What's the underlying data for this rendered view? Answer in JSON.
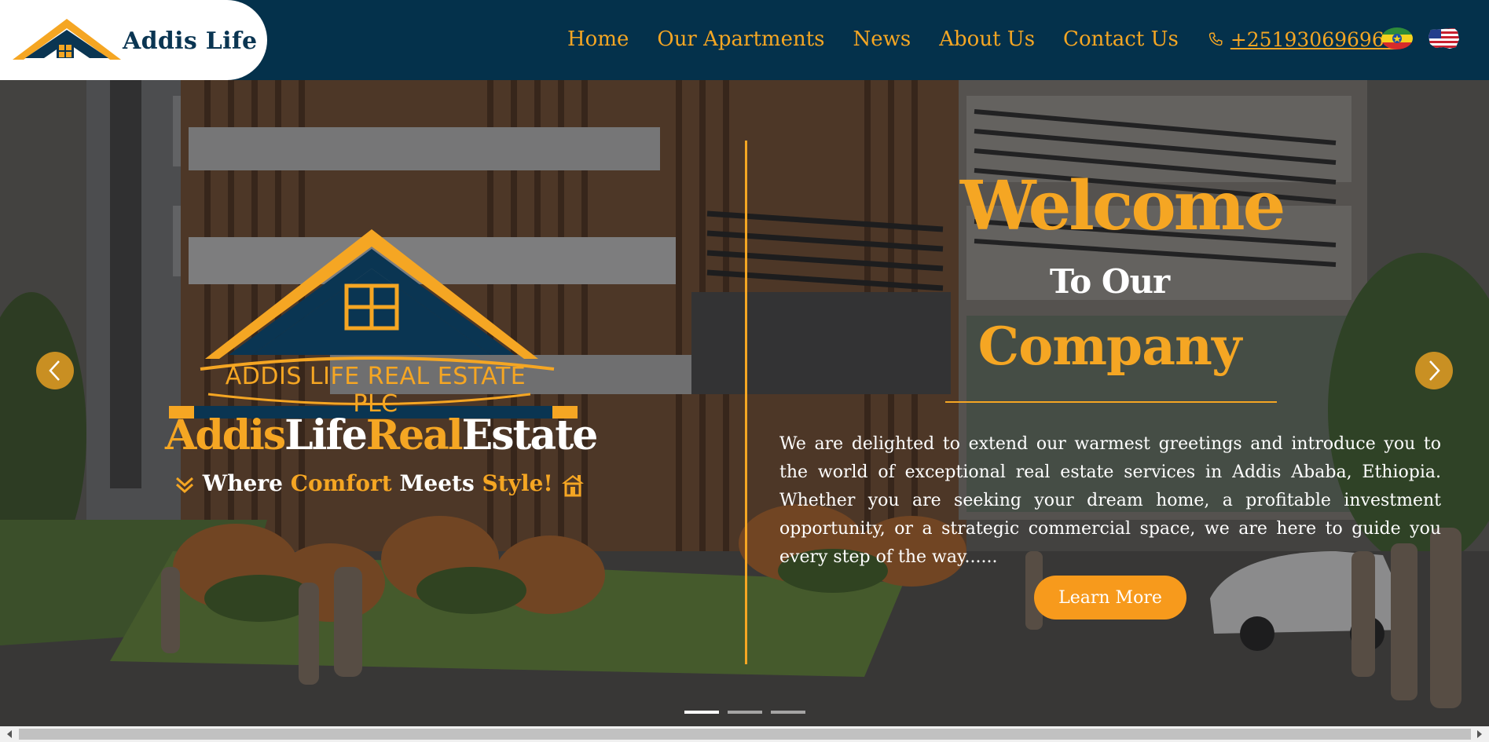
{
  "header": {
    "logo_text": "Addis Life",
    "nav": [
      {
        "label": "Home"
      },
      {
        "label": "Our Apartments"
      },
      {
        "label": "News"
      },
      {
        "label": "About Us"
      },
      {
        "label": "Contact Us"
      }
    ],
    "phone": "+251930696969",
    "flags": [
      "ethiopia-flag-icon",
      "usa-flag-icon"
    ]
  },
  "hero": {
    "brand_plc": "ADDIS LIFE REAL ESTATE PLC",
    "brand_title": {
      "part1": "Addis",
      "part2": "Life",
      "part3": "Real",
      "part4": "Estate"
    },
    "tagline": {
      "part1": "Where",
      "part2": "Comfort",
      "part3": "Meets",
      "part4": "Style!"
    },
    "welcome": "Welcome",
    "to_our": "To Our",
    "company": "Company",
    "intro": "We are delighted to extend our warmest greetings and introduce you to the world of exceptional real estate services in Addis Ababa, Ethiopia. Whether you are seeking your dream home, a profitable investment opportunity, or a strategic commercial space, we are here to guide you every step of the way......",
    "cta": "Learn More",
    "slides": {
      "count": 3,
      "active": 1
    }
  },
  "colors": {
    "navy": "#04314b",
    "orange": "#f5a623",
    "button": "#f79a1c",
    "white": "#ffffff"
  }
}
